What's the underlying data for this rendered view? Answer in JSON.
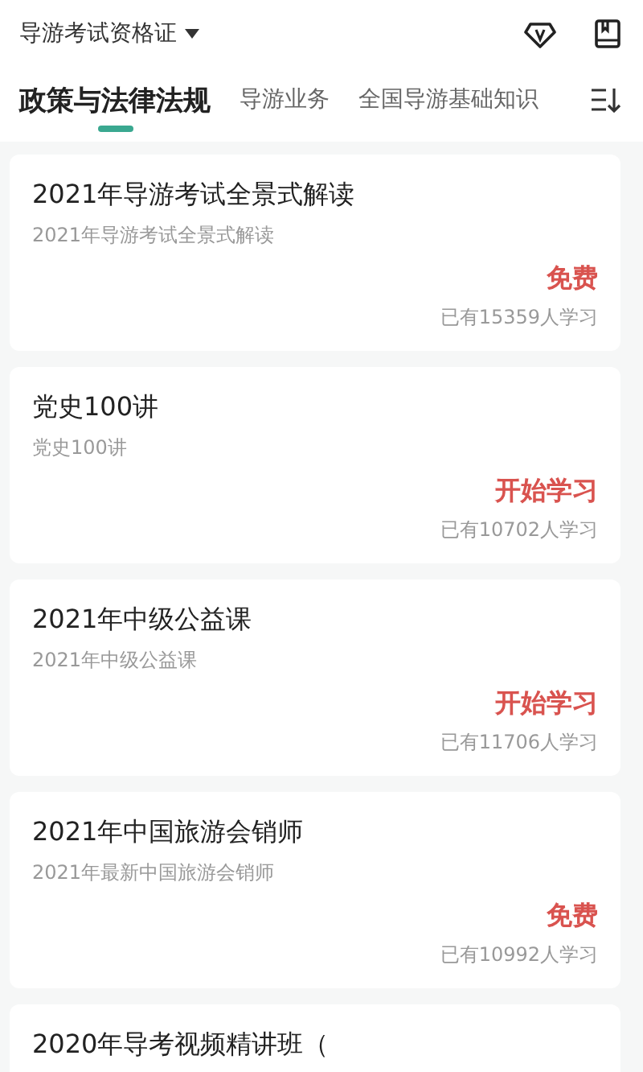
{
  "header": {
    "title": "导游考试资格证"
  },
  "tabs": [
    {
      "label": "政策与法律法规",
      "selected": true
    },
    {
      "label": "导游业务",
      "selected": false
    },
    {
      "label": "全国导游基础知识",
      "selected": false
    }
  ],
  "courses": [
    {
      "title": "2021年导游考试全景式解读",
      "subtitle": "2021年导游考试全景式解读",
      "action": "免费",
      "learners": "已有15359人学习"
    },
    {
      "title": "党史100讲",
      "subtitle": "党史100讲",
      "action": "开始学习",
      "learners": "已有10702人学习"
    },
    {
      "title": "2021年中级公益课",
      "subtitle": "2021年中级公益课",
      "action": "开始学习",
      "learners": "已有11706人学习"
    },
    {
      "title": "2021年中国旅游会销师",
      "subtitle": "2021年最新中国旅游会销师",
      "action": "免费",
      "learners": "已有10992人学习"
    },
    {
      "title": "2020年导考视频精讲班（"
    }
  ]
}
